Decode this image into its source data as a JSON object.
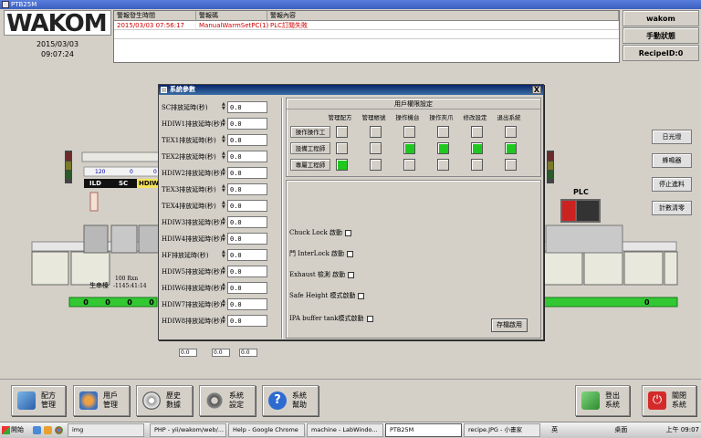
{
  "window": {
    "title": "PTB25M"
  },
  "header": {
    "logo_text": "WAKOM",
    "date": "2015/03/03",
    "time": "09:07:24"
  },
  "alarm_table": {
    "columns": [
      "警報發生時間",
      "警報碼",
      "警報內容"
    ],
    "rows": [
      {
        "time": "2015/03/03 07:56:17",
        "code": "ManualWarmSetPC(1)",
        "content": "PLC訂閱失敗"
      }
    ]
  },
  "right_panel": {
    "user": "wakom",
    "mode": "手動狀態",
    "recipe": "RecipeID:0"
  },
  "machine": {
    "counters": [
      "120",
      "0",
      "0"
    ],
    "tags": [
      "ILD",
      "SC",
      "HDIW"
    ],
    "plc_label": "PLC",
    "left_station_label": "生串檯",
    "speed": "100 Rxn",
    "speed_value": "-1145:41:14",
    "bottom_values": [
      "0",
      "0",
      "0",
      "0",
      "0"
    ],
    "lower_readouts": [
      "0.0",
      "0.0",
      "0.0"
    ],
    "side_buttons": [
      "日光燈",
      "蜂鳴器",
      "停止進料",
      "計數清零"
    ]
  },
  "dialog": {
    "title": "系統參數",
    "close": "X",
    "params": [
      {
        "label": "SC排放延時(秒)",
        "value": "0.0"
      },
      {
        "label": "HDIW1排放延時(秒)",
        "value": "0.0"
      },
      {
        "label": "TEX1排放延時(秒)",
        "value": "0.0"
      },
      {
        "label": "TEX2排放延時(秒)",
        "value": "0.0"
      },
      {
        "label": "HDIW2排放延時(秒)",
        "value": "0.0"
      },
      {
        "label": "TEX3排放延時(秒)",
        "value": "0.0"
      },
      {
        "label": "TEX4排放延時(秒)",
        "value": "0.0"
      },
      {
        "label": "HDIW3排放延時(秒)",
        "value": "0.0"
      },
      {
        "label": "HDIW4排放延時(秒)",
        "value": "0.0"
      },
      {
        "label": "HF排放延時(秒)",
        "value": "0.0"
      },
      {
        "label": "HDIW5排放延時(秒)",
        "value": "0.0"
      },
      {
        "label": "HDIW6排放延時(秒)",
        "value": "0.0"
      },
      {
        "label": "HDIW7排放延時(秒)",
        "value": "0.0"
      },
      {
        "label": "HDIW8排放延時(秒)",
        "value": "0.0"
      }
    ],
    "permissions": {
      "title": "用戶權限設定",
      "columns": [
        "管理配方",
        "管理帳號",
        "操作機台",
        "操作夾爪",
        "修改設定",
        "退出系統"
      ],
      "roles": [
        {
          "name": "操作操作工",
          "checks": [
            false,
            false,
            false,
            false,
            false,
            false
          ]
        },
        {
          "name": "設備工程師",
          "checks": [
            false,
            false,
            true,
            true,
            true,
            true
          ]
        },
        {
          "name": "專屬工程師",
          "checks": [
            true,
            false,
            false,
            false,
            false,
            false
          ]
        }
      ]
    },
    "options": [
      "Chuck Lock 啟動",
      "門 InterLock 啟動",
      "Exhaust 檢測 啟動",
      "Safe Height 模式啟動",
      "IPA buffer tank模式啟動"
    ],
    "save_label": "存檔啟用"
  },
  "bottom_buttons": [
    {
      "label": "配方\n管理",
      "icon": "recipe-icon"
    },
    {
      "label": "用戶\n管理",
      "icon": "users-icon"
    },
    {
      "label": "歷史\n數據",
      "icon": "history-icon"
    },
    {
      "label": "系統\n設定",
      "icon": "settings-icon"
    },
    {
      "label": "系統\n幫助",
      "icon": "help-icon"
    },
    {
      "label": "登出\n系統",
      "icon": "logout-icon"
    },
    {
      "label": "關閉\n系統",
      "icon": "power-icon"
    }
  ],
  "taskbar": {
    "start": "開始",
    "tasks": [
      "img",
      "PHP - yii/wakom/web/...",
      "Help - Google Chrome",
      "machine - LabWindo...",
      "PTB25M",
      "recipe.JPG - 小畫家"
    ],
    "tray_ime": "英",
    "tray_desktop": "桌面",
    "clock": "上午 09:07"
  },
  "colors": {
    "title_blue": "#0a246a",
    "checkbox_on": "#1ec81e",
    "alarm_red": "#d00000",
    "counter_green": "#32c832"
  }
}
